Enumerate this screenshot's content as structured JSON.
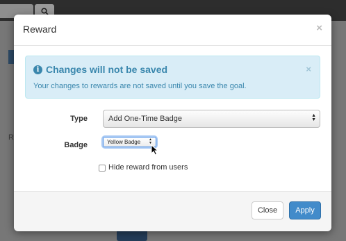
{
  "background": {
    "search_button_icon": "search-icon",
    "partial_label": "R"
  },
  "modal": {
    "title": "Reward",
    "close_icon": "×"
  },
  "alert": {
    "icon": "info-circle-icon",
    "title": "Changes will not be saved",
    "message": "Your changes to rewards are not saved until you save the goal.",
    "close_icon": "×"
  },
  "form": {
    "type_label": "Type",
    "type_value": "Add One-Time Badge",
    "badge_label": "Badge",
    "badge_value": "Yellow Badge",
    "hide_reward_label": "Hide reward from users",
    "hide_reward_checked": false
  },
  "footer": {
    "close_label": "Close",
    "apply_label": "Apply"
  },
  "colors": {
    "primary": "#428bca",
    "info_text": "#3a87ad",
    "info_bg": "#d9edf7"
  }
}
